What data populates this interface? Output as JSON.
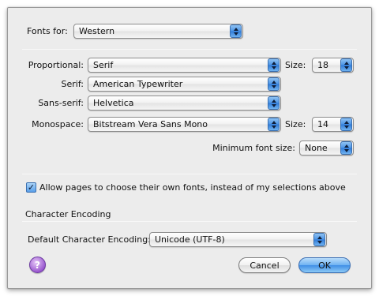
{
  "fonts_for": {
    "label": "Fonts for:",
    "value": "Western"
  },
  "proportional": {
    "label": "Proportional:",
    "value": "Serif",
    "size_label": "Size:",
    "size_value": "18"
  },
  "serif": {
    "label": "Serif:",
    "value": "American Typewriter"
  },
  "sans_serif": {
    "label": "Sans-serif:",
    "value": "Helvetica"
  },
  "monospace": {
    "label": "Monospace:",
    "value": "Bitstream Vera Sans Mono",
    "size_label": "Size:",
    "size_value": "14"
  },
  "minimum_font_size": {
    "label": "Minimum font size:",
    "value": "None"
  },
  "allow_pages": {
    "checked": true,
    "label": "Allow pages to choose their own fonts, instead of my selections above"
  },
  "character_encoding": {
    "section_title": "Character Encoding",
    "default_label": "Default Character Encoding:",
    "default_value": "Unicode (UTF-8)"
  },
  "buttons": {
    "help": "?",
    "cancel": "Cancel",
    "ok": "OK"
  },
  "icons": {
    "popup_arrows": "up-down-chevron-icon",
    "check": "checkmark-icon",
    "help": "help-icon"
  },
  "colors": {
    "accent": "#4a93e6",
    "help": "#9b59d0",
    "dialog_bg": "#ececec"
  }
}
